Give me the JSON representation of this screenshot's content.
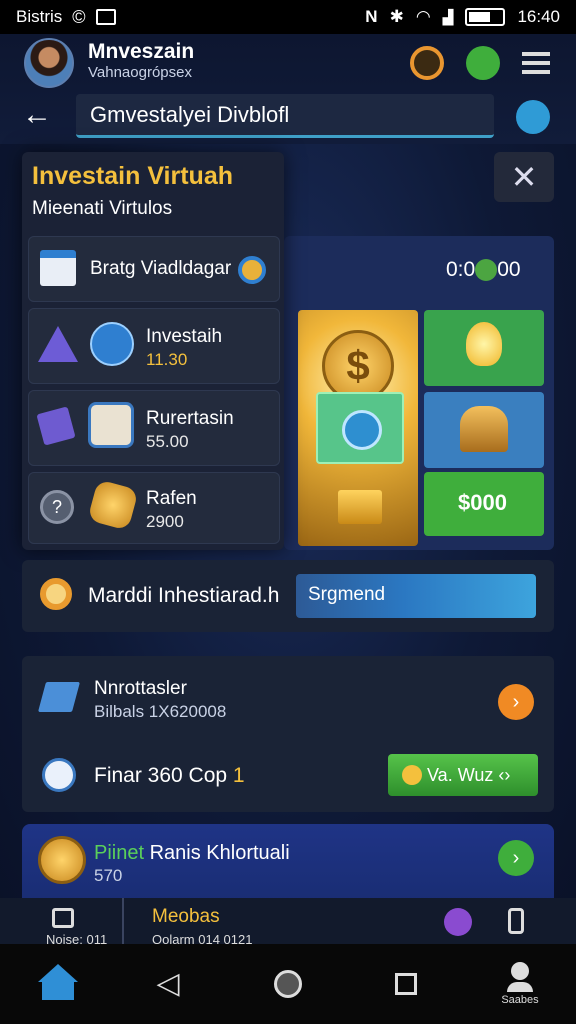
{
  "status_bar": {
    "carrier": "Bistris",
    "time": "16:40",
    "battery_percent": 65
  },
  "header": {
    "app_title": "Mnveszain",
    "app_subtitle": "Vahnaogrópsex",
    "search_value": "Gmvestalyei Divblofl"
  },
  "panel": {
    "title": "Investain Virtuah",
    "subtitle": "Mieenati Virtulos",
    "items": [
      {
        "label": "Bratg Viadldagar",
        "value": ""
      },
      {
        "label": "Investaih",
        "value": "11.30"
      },
      {
        "label": "Rurertasin",
        "value": "55.00"
      },
      {
        "label": "Rafen",
        "value": "2900"
      }
    ]
  },
  "board": {
    "timer": "0:0",
    "timer_tail": "00",
    "tiles": [
      {
        "label": "$"
      },
      {
        "label": "$000"
      }
    ]
  },
  "search_row": {
    "label": "Marddi Inhestiarad.h",
    "input_value": "Srgmend"
  },
  "card": {
    "row1_title": "Nnrottasler",
    "row1_sub": "Bilbals 1X620008",
    "row2_title": "Finar 360 Cop",
    "row2_badge": "1",
    "action_label": "Va. Wuz"
  },
  "promo": {
    "highlight": "Piinet",
    "title": "Ranis Khlortuali",
    "sub": "570"
  },
  "bottom_strip": {
    "left_text": "Noise: 011",
    "center_title": "Meobas",
    "center_sub": "Qolarm 014 0121"
  },
  "navbar": {
    "profile_label": "Saabes"
  }
}
